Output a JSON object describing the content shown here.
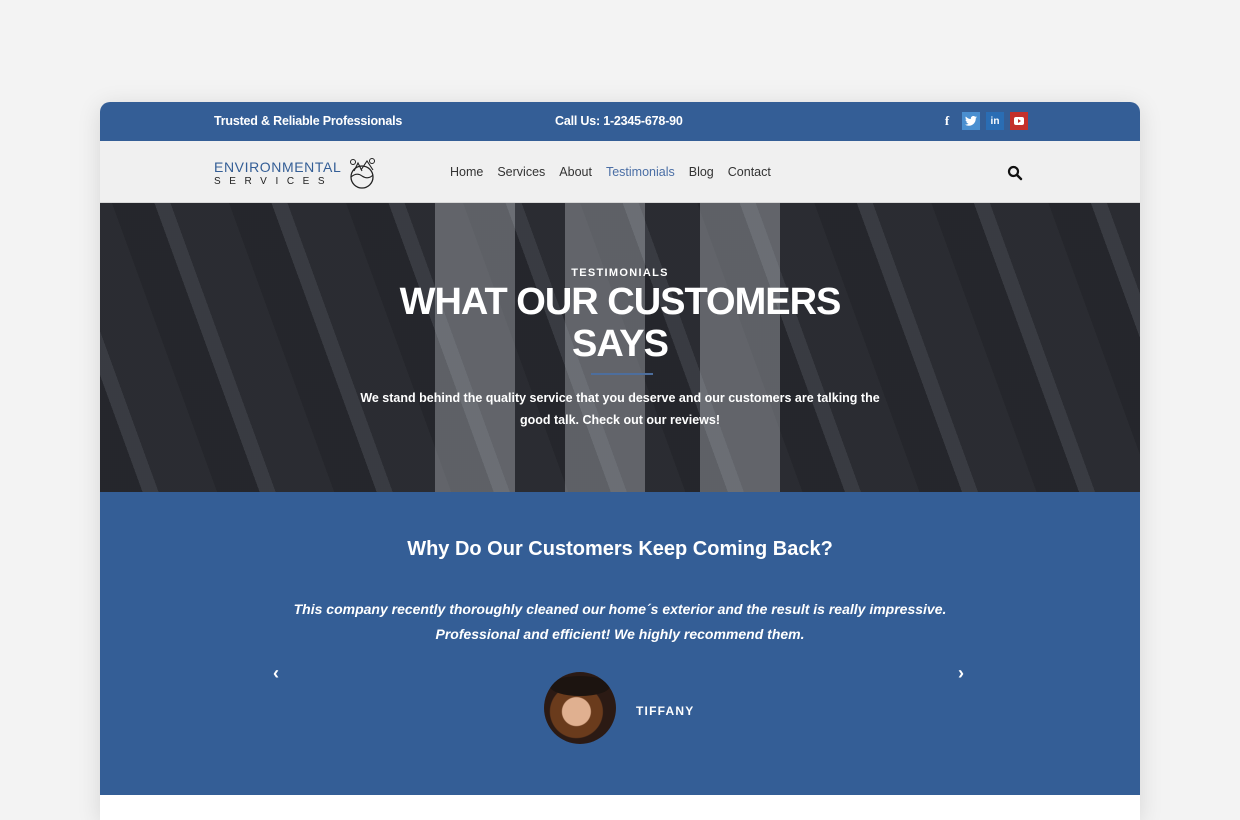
{
  "topbar": {
    "tagline": "Trusted & Reliable Professionals",
    "phone": "Call Us: 1-2345-678-90",
    "socials": [
      {
        "name": "facebook",
        "glyph": "f"
      },
      {
        "name": "twitter",
        "glyph": "t"
      },
      {
        "name": "linkedin",
        "glyph": "in"
      },
      {
        "name": "youtube",
        "glyph": "▶"
      }
    ]
  },
  "logo": {
    "line1": "ENVIRONMENTAL",
    "line2": "SERVICES"
  },
  "nav": {
    "items": [
      {
        "label": "Home"
      },
      {
        "label": "Services"
      },
      {
        "label": "About"
      },
      {
        "label": "Testimonials",
        "active": true
      },
      {
        "label": "Blog"
      },
      {
        "label": "Contact"
      }
    ],
    "search_icon": "search-icon"
  },
  "hero": {
    "eyebrow": "TESTIMONIALS",
    "title": "WHAT OUR CUSTOMERS SAYS",
    "description": "We stand behind the quality service that you deserve and our customers are talking the good talk. Check out our reviews!"
  },
  "testimonials": {
    "heading": "Why Do Our Customers Keep Coming Back?",
    "quote": "This company recently thoroughly cleaned our home´s exterior and the result is really impressive. Professional and efficient! We highly recommend them.",
    "author": "TIFFANY",
    "prev_icon": "‹",
    "next_icon": "›"
  },
  "colors": {
    "brand_blue": "#345e96",
    "nav_active": "#4a6ea5",
    "twitter": "#4a8fd0",
    "linkedin": "#2a6db4",
    "youtube": "#c4302b"
  }
}
